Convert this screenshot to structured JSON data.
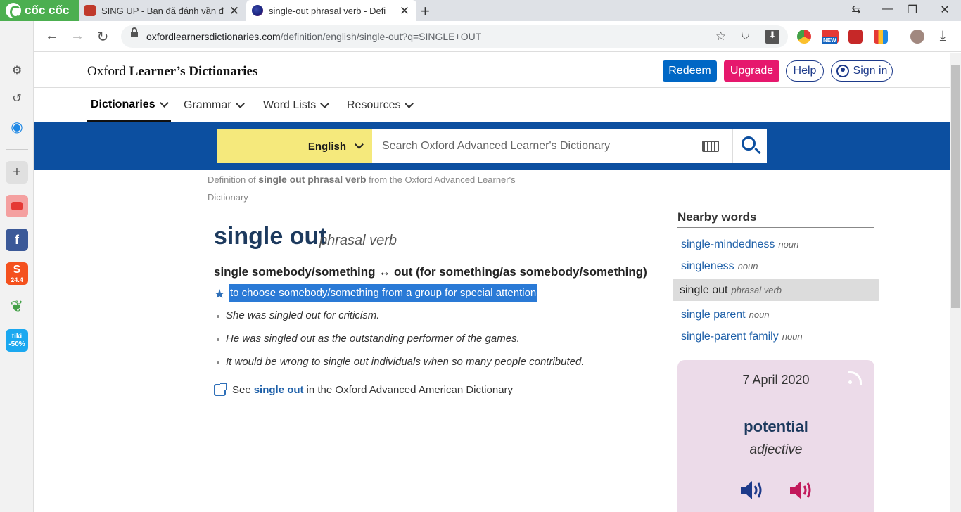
{
  "browser": {
    "brand": "cốc cốc",
    "tabs": [
      {
        "title": "SING UP - Bạn đã đánh vần đ"
      },
      {
        "title": "single-out phrasal verb - Defi"
      }
    ],
    "url_host": "oxfordlearnersdictionaries.com",
    "url_path": "/definition/english/single-out?q=SINGLE+OUT",
    "ext_new_badge": "NEW"
  },
  "sidebar": {
    "shopee_badge": "24.4",
    "tiki_label": "tiki",
    "tiki_discount": "-50%"
  },
  "site": {
    "brand_light": "Oxford",
    "brand_bold": "Learner’s Dictionaries",
    "redeem": "Redeem",
    "upgrade": "Upgrade",
    "help": "Help",
    "signin": "Sign in",
    "nav": [
      "Dictionaries",
      "Grammar",
      "Word Lists",
      "Resources"
    ]
  },
  "search": {
    "language": "English",
    "placeholder": "Search Oxford Advanced Learner's Dictionary"
  },
  "breadcrumb": {
    "prefix": "Definition of",
    "term": "single out phrasal verb",
    "suffix": "from the Oxford Advanced Learner's Dictionary"
  },
  "entry": {
    "headword": "single out",
    "pos": "phrasal verb",
    "pattern": "single somebody/something ↔ out (for something/as somebody/something)",
    "definition": "to choose somebody/something from a group for special attention",
    "examples": [
      "She was singled out for criticism.",
      "He was singled out as the outstanding performer of the games.",
      "It would be wrong to single out individuals when so many people contributed."
    ],
    "see_prefix": "See",
    "see_link": "single out",
    "see_suffix": "in the Oxford Advanced American Dictionary"
  },
  "nearby": {
    "title": "Nearby words",
    "items": [
      {
        "word": "single-mindedness",
        "pos": "noun"
      },
      {
        "word": "singleness",
        "pos": "noun"
      },
      {
        "word": "single out",
        "pos": "phrasal verb",
        "current": true
      },
      {
        "word": "single parent",
        "pos": "noun"
      },
      {
        "word": "single-parent family",
        "pos": "noun"
      }
    ]
  },
  "word_of_the_day": {
    "date": "7 April 2020",
    "word": "potential",
    "pos": "adjective"
  },
  "colors": {
    "search_band": "#0c4fa0",
    "highlight": "#2a7ad6",
    "redeem": "#0067c5",
    "upgrade": "#e6186d",
    "wotd_bg": "#ecdbe9"
  }
}
